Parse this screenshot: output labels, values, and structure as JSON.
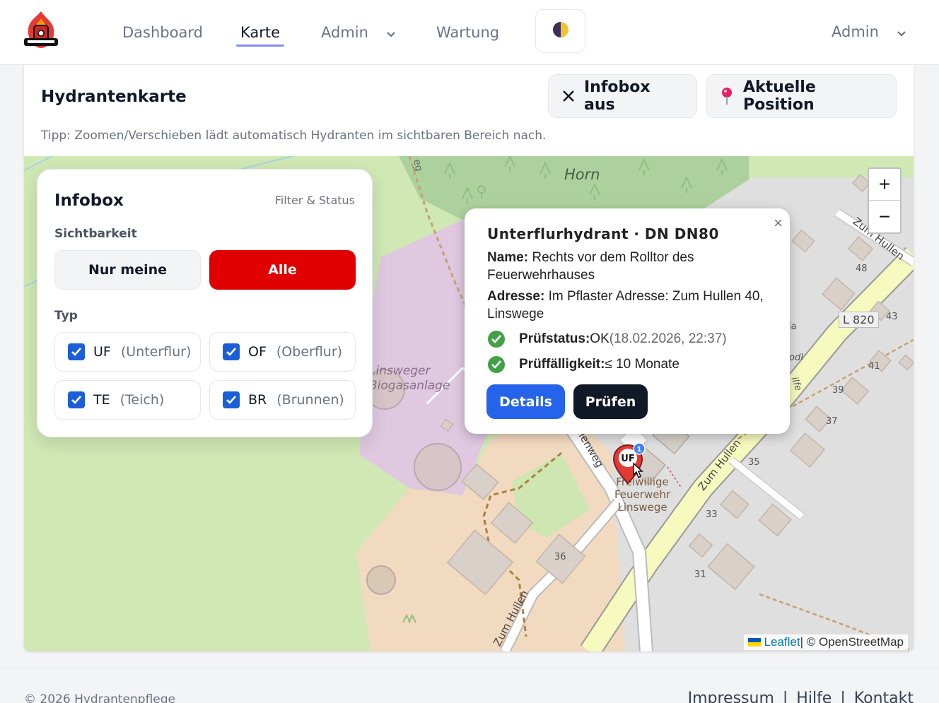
{
  "nav": {
    "items": [
      {
        "label": "Dashboard"
      },
      {
        "label": "Karte"
      },
      {
        "label": "Admin"
      },
      {
        "label": "Wartung"
      }
    ],
    "user": "Admin"
  },
  "header": {
    "title": "Hydrantenkarte",
    "infobox_button": "Infobox aus",
    "position_button": "Aktuelle Position",
    "tip": "Tipp: Zoomen/Verschieben lädt automatisch Hydranten im sichtbaren Bereich nach."
  },
  "map": {
    "labels": {
      "horn": "Horn",
      "road_l820": "L 820",
      "biogas": "Linsweger\nBiogasanlage",
      "feuerwehr": "Freiwillige\nFeuerwehr\nLinswege",
      "zum_hullen_1": "Zum Hullen",
      "zum_hullen_2": "Zum Hullen",
      "zum_hullen_3": "Zum Hullen",
      "lenweg": "llenweg",
      "weg": "eg",
      "house_48": "48",
      "house_43": "43",
      "house_41": "41",
      "house_39": "39",
      "house_37": "37",
      "house_35": "35",
      "house_33": "33",
      "house_31": "31",
      "house_36": "36",
      "frag_ja": "ia",
      "frag_odl": "odl",
      "frag_ilfe": "ilfe"
    },
    "zoom_in": "+",
    "zoom_out": "−",
    "attribution_leaflet": "Leaflet",
    "attribution_sep": " | © OpenStreetMap",
    "marker_label": "UF",
    "marker_badge": "1"
  },
  "infobox": {
    "title": "Infobox",
    "subtitle": "Filter & Status",
    "visibility_label": "Sichtbarkeit",
    "only_mine": "Nur meine",
    "all": "Alle",
    "type_label": "Typ",
    "types": [
      {
        "code": "UF",
        "desc": "(Unterflur)"
      },
      {
        "code": "OF",
        "desc": "(Oberflur)"
      },
      {
        "code": "TE",
        "desc": "(Teich)"
      },
      {
        "code": "BR",
        "desc": "(Brunnen)"
      }
    ]
  },
  "popup": {
    "title": "Unterflurhydrant · DN DN80",
    "name_label": "Name:",
    "name_value": " Rechts vor dem Rolltor des Feuerwehrhauses",
    "address_label": "Adresse:",
    "address_value": " Im Pflaster Adresse: Zum Hullen 40, Linswege",
    "status_label": "Prüfstatus:",
    "status_value": " OK",
    "status_date": " (18.02.2026, 22:37)",
    "due_label": "Prüffälligkeit:",
    "due_value": " ≤ 10 Monate",
    "details_button": "Details",
    "check_button": "Prüfen",
    "close": "×"
  },
  "footer": {
    "copyright": "© 2026 Hydrantenpflege",
    "links": [
      "Impressum",
      "Hilfe",
      "Kontakt"
    ],
    "separator": "|"
  },
  "colors": {
    "accent_red": "#e00000",
    "primary_blue": "#2563eb",
    "dark": "#111827",
    "nav_underline": "#818cf8",
    "ok_green": "#4caf50"
  }
}
